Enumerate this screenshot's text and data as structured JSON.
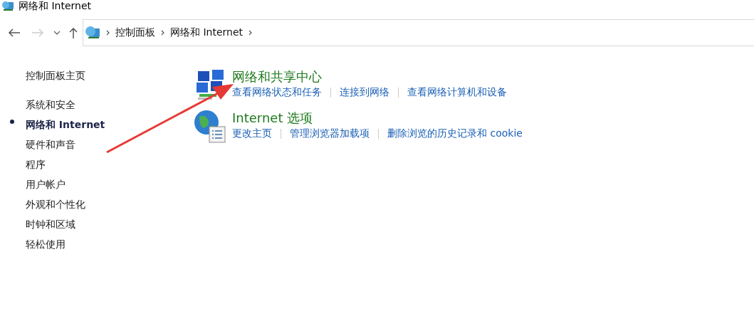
{
  "window": {
    "title": "网络和 Internet"
  },
  "address_bar": {
    "crumbs": [
      "控制面板",
      "网络和 Internet"
    ]
  },
  "sidebar": {
    "home": "控制面板主页",
    "items": [
      {
        "label": "系统和安全",
        "selected": false
      },
      {
        "label": "网络和 Internet",
        "selected": true
      },
      {
        "label": "硬件和声音",
        "selected": false
      },
      {
        "label": "程序",
        "selected": false
      },
      {
        "label": "用户帐户",
        "selected": false
      },
      {
        "label": "外观和个性化",
        "selected": false
      },
      {
        "label": "时钟和区域",
        "selected": false
      },
      {
        "label": "轻松使用",
        "selected": false
      }
    ]
  },
  "categories": [
    {
      "kind": "network",
      "title": "网络和共享中心",
      "links": [
        "查看网络状态和任务",
        "连接到网络",
        "查看网络计算机和设备"
      ]
    },
    {
      "kind": "globe",
      "title": "Internet 选项",
      "links": [
        "更改主页",
        "管理浏览器加载项",
        "删除浏览的历史记录和 cookie"
      ]
    }
  ]
}
